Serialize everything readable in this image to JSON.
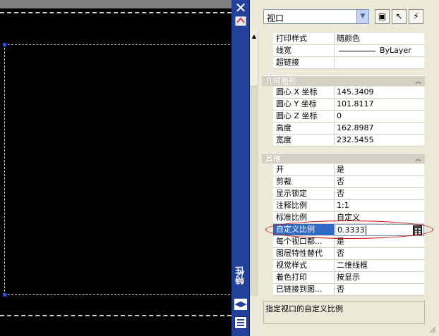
{
  "object_selector": {
    "value": "视口"
  },
  "toolbar": [
    {
      "icon": "toggle-pickadd-icon",
      "glyph": "▣"
    },
    {
      "icon": "select-objects-icon",
      "glyph": "↖"
    },
    {
      "icon": "quick-select-icon",
      "glyph": "⚡"
    }
  ],
  "palette_title": "特性",
  "rows_top": [
    {
      "label": "打印样式",
      "value": "随颜色"
    },
    {
      "label": "线宽",
      "value": "ByLayer"
    },
    {
      "label": "超链接",
      "value": ""
    }
  ],
  "geometry": {
    "header": "几何图形",
    "rows": [
      {
        "label": "圆心 X 坐标",
        "value": "145.3409"
      },
      {
        "label": "圆心 Y 坐标",
        "value": "101.8117"
      },
      {
        "label": "圆心 Z 坐标",
        "value": "0"
      },
      {
        "label": "高度",
        "value": "162.8987"
      },
      {
        "label": "宽度",
        "value": "232.5455"
      }
    ]
  },
  "misc": {
    "header": "其他",
    "rows": [
      {
        "label": "开",
        "value": "是"
      },
      {
        "label": "剪裁",
        "value": "否"
      },
      {
        "label": "显示锁定",
        "value": "否"
      },
      {
        "label": "注释比例",
        "value": "1:1"
      },
      {
        "label": "标准比例",
        "value": "自定义"
      },
      {
        "label": "自定义比例",
        "value": "0.3333"
      },
      {
        "label": "每个视口都...",
        "value": "是"
      },
      {
        "label": "图层特性替代",
        "value": "否"
      },
      {
        "label": "视觉样式",
        "value": "二维线框"
      },
      {
        "label": "着色打印",
        "value": "按显示"
      },
      {
        "label": "已链接到图...",
        "value": "否"
      }
    ]
  },
  "description": "指定视口的自定义比例",
  "colors": {
    "title_bar": "#22409c",
    "selected": "#316ac5",
    "highlight_ellipse": "#cc0000"
  }
}
